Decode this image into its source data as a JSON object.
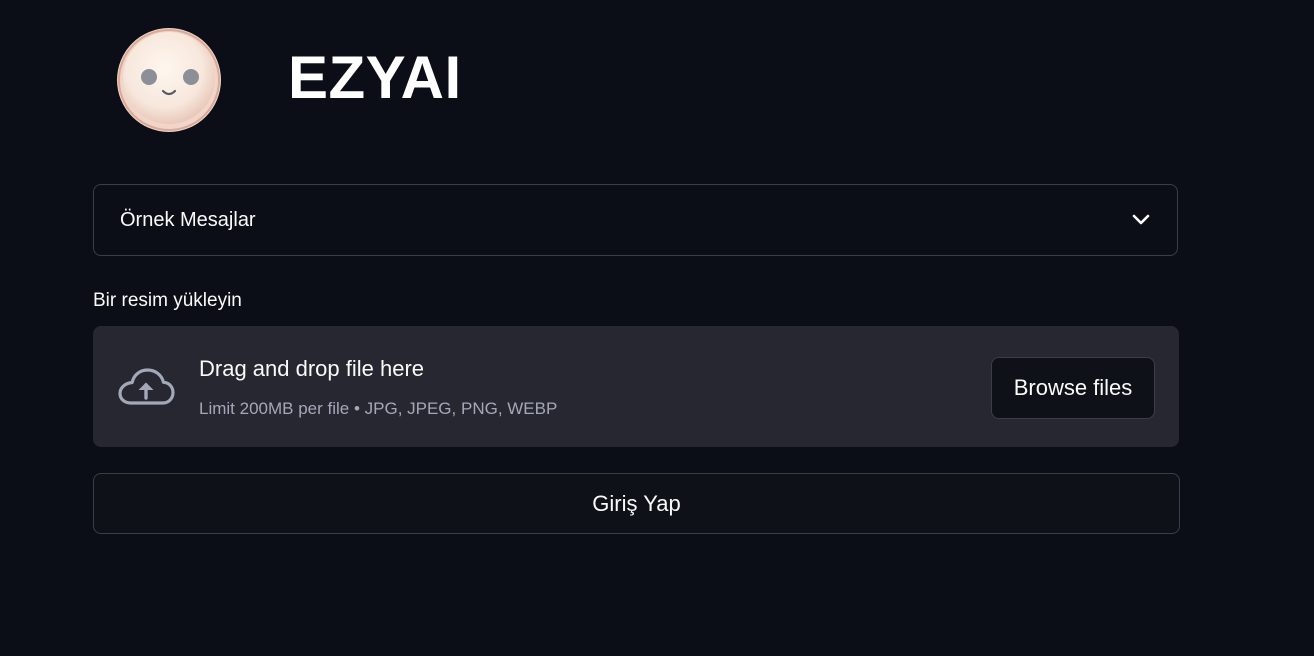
{
  "header": {
    "title": "EZYAI",
    "logo_icon": "smiley-face-icon"
  },
  "examples": {
    "label": "Örnek Mesajlar",
    "icon": "chevron-down-icon"
  },
  "uploader": {
    "label": "Bir resim yükleyin",
    "drop_title": "Drag and drop file here",
    "drop_subtitle": "Limit 200MB per file • JPG, JPEG, PNG, WEBP",
    "browse_label": "Browse files",
    "icon": "cloud-upload-icon"
  },
  "login": {
    "label": "Giriş Yap"
  },
  "colors": {
    "background": "#0b0e16",
    "surface": "#262730",
    "border": "#3a3e49",
    "text": "#fafafa",
    "muted_text": "#a3a8b8"
  }
}
